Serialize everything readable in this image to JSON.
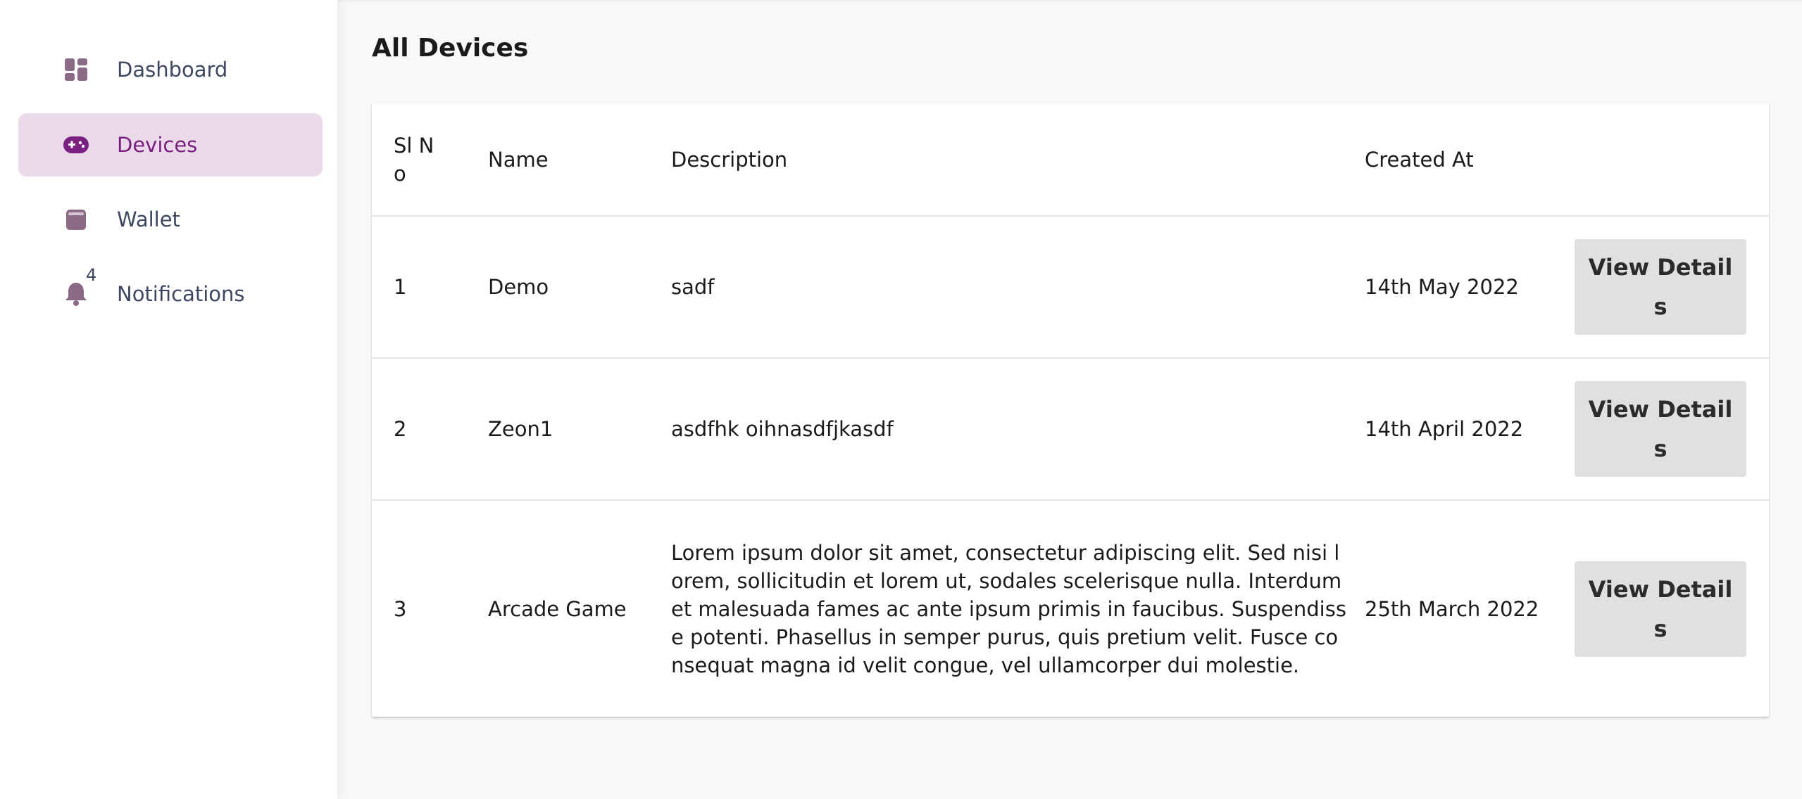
{
  "sidebar": {
    "items": [
      {
        "label": "Dashboard",
        "icon": "dashboard-icon"
      },
      {
        "label": "Devices",
        "icon": "gamepad-icon",
        "active": true
      },
      {
        "label": "Wallet",
        "icon": "wallet-icon"
      },
      {
        "label": "Notifications",
        "icon": "bell-icon",
        "badge": "4"
      }
    ]
  },
  "main": {
    "title": "All Devices",
    "table": {
      "headers": {
        "sl": "Sl No",
        "name": "Name",
        "description": "Description",
        "created": "Created At"
      },
      "rows": [
        {
          "sl": "1",
          "name": "Demo",
          "description": "sadf",
          "created": "14th May 2022",
          "action": "View Details"
        },
        {
          "sl": "2",
          "name": "Zeon1",
          "description": "asdfhk oihnasdfjkasdf",
          "created": "14th April 2022",
          "action": "View Details"
        },
        {
          "sl": "3",
          "name": "Arcade Game",
          "description": "Lorem ipsum dolor sit amet, consectetur adipiscing elit. Sed nisi lorem, sollicitudin et lorem ut, sodales scelerisque nulla. Interdum et malesuada fames ac ante ipsum primis in faucibus. Suspendisse potenti. Phasellus in semper purus, quis pretium velit. Fusce consequat magna id velit congue, vel ullamcorper dui molestie.",
          "created": "25th March 2022",
          "action": "View Details"
        }
      ]
    }
  },
  "colors": {
    "accent": "#7b2080",
    "active_bg": "#eadaea",
    "icon": "#8b6a86",
    "nav_text": "#3d4760",
    "button_bg": "#e0e0e0"
  }
}
